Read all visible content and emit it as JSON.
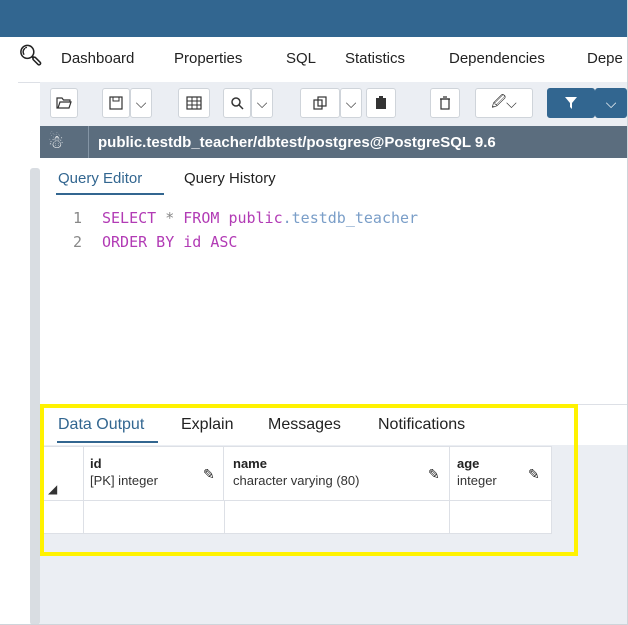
{
  "main_tabs": [
    "Dashboard",
    "Properties",
    "SQL",
    "Statistics",
    "Dependencies",
    "Depe"
  ],
  "connection_path": "public.testdb_teacher/dbtest/postgres@PostgreSQL 9.6",
  "query_tabs": [
    "Query Editor",
    "Query History"
  ],
  "code": {
    "line_numbers": [
      "1",
      "2"
    ],
    "line1": {
      "kw1": "SELECT",
      "op": "*",
      "kw2": "FROM",
      "schema": "public",
      "dot": ".",
      "table": "testdb_teacher"
    },
    "line2": {
      "kw1": "ORDER BY",
      "ident": "id",
      "kw2": "ASC"
    }
  },
  "result_tabs": [
    "Data Output",
    "Explain",
    "Messages",
    "Notifications"
  ],
  "columns": [
    {
      "name": "id",
      "type": "[PK] integer"
    },
    {
      "name": "name",
      "type": "character varying (80)"
    },
    {
      "name": "age",
      "type": "integer"
    }
  ],
  "icons": {
    "search": "search-icon",
    "open": "folder-open-icon",
    "save": "save-icon",
    "path": "connection-icon",
    "pencil": "pencil-icon"
  },
  "colors": {
    "accent": "#326690",
    "highlight": "#fff200",
    "keyword": "#b23bb5"
  }
}
